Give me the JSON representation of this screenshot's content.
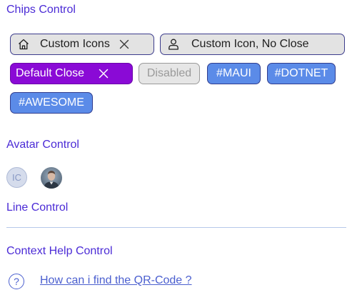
{
  "sections": {
    "chips_title": "Chips Control",
    "avatar_title": "Avatar Control",
    "line_title": "Line Control",
    "help_title": "Context Help Control"
  },
  "chips": {
    "custom_icons": {
      "label": "Custom Icons",
      "icon": "home-icon",
      "closable": true
    },
    "custom_icon_no_close": {
      "label": "Custom Icon, No Close",
      "icon": "person-icon",
      "closable": false
    },
    "default_close": {
      "label": "Default Close",
      "closable": true
    },
    "disabled": {
      "label": "Disabled"
    },
    "maui": {
      "label": "#MAUI"
    },
    "dotnet": {
      "label": "#DOTNET"
    },
    "awesome": {
      "label": "#AWESOME"
    }
  },
  "avatars": {
    "initials": "IC",
    "photo": "person-photo"
  },
  "help": {
    "icon": "question-icon",
    "icon_glyph": "?",
    "link_text": "How can i find the QR-Code ?"
  },
  "colors": {
    "title": "#4b2bd6",
    "chip_outline_border": "#3c3c8c",
    "chip_purple": "#8a0ad6",
    "chip_blue": "#5b8be8",
    "link": "#4b5fcf",
    "divider": "#b6c8ea"
  }
}
